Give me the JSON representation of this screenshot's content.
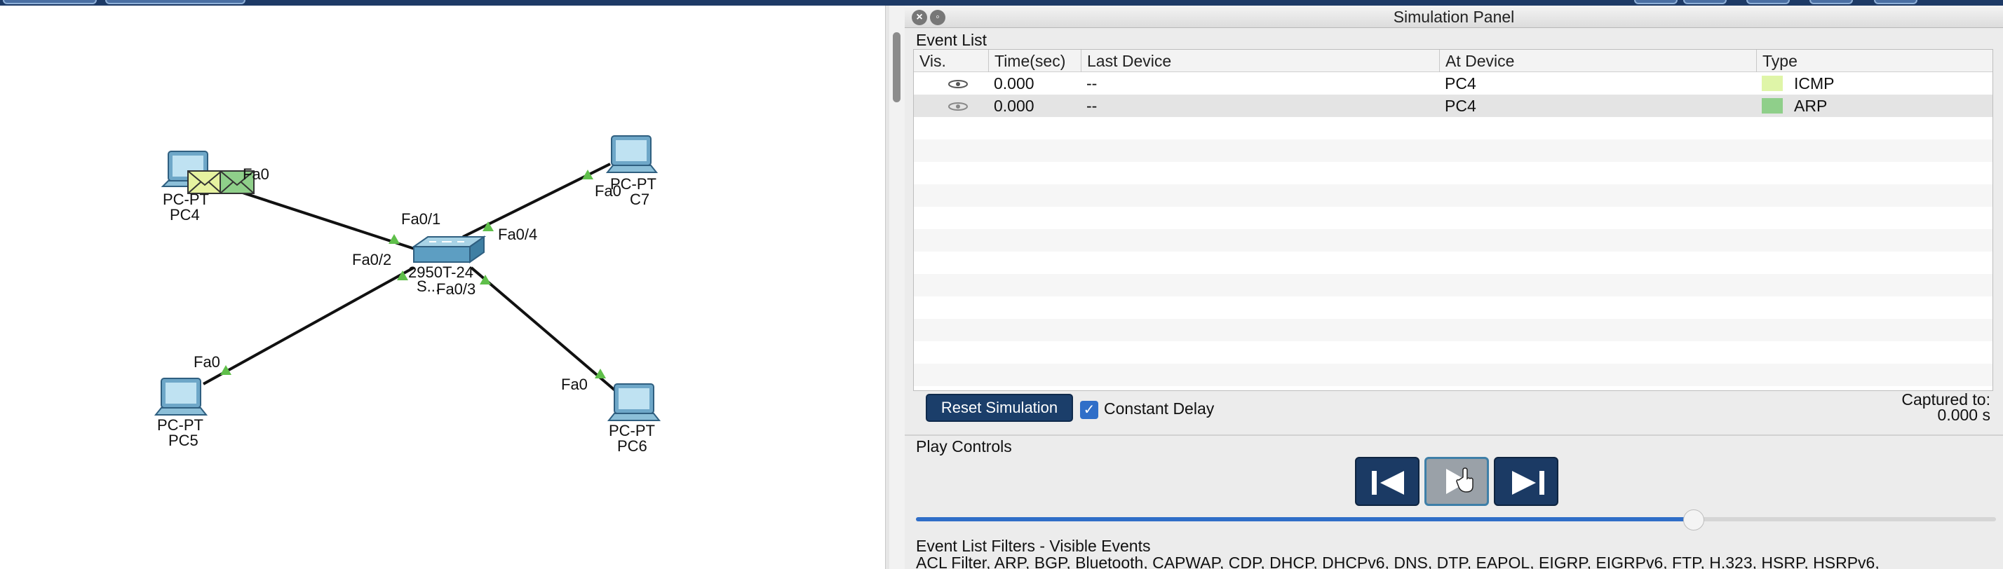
{
  "topology": {
    "devices": {
      "pc4": {
        "model": "PC-PT",
        "name": "PC4"
      },
      "pc5": {
        "model": "PC-PT",
        "name": "PC5"
      },
      "pc6": {
        "model": "PC-PT",
        "name": "PC6"
      },
      "pc7": {
        "model": "PC-PT",
        "name": "C7"
      },
      "switch": {
        "model": "2950T-24",
        "name": "S..."
      }
    },
    "ports": {
      "pc4_fa0": "Fa0",
      "pc5_fa0": "Fa0",
      "pc6_fa0": "Fa0",
      "pc7_fa0": "Fa0",
      "sw_fa01": "Fa0/1",
      "sw_fa02": "Fa0/2",
      "sw_fa03": "Fa0/3",
      "sw_fa04": "Fa0/4"
    }
  },
  "sim_panel": {
    "title": "Simulation Panel",
    "event_list_label": "Event List",
    "columns": [
      "Vis.",
      "Time(sec)",
      "Last Device",
      "At Device",
      "Type"
    ],
    "events": [
      {
        "time": "0.000",
        "last_device": "--",
        "at_device": "PC4",
        "type": "ICMP",
        "color": "#dff5a8"
      },
      {
        "time": "0.000",
        "last_device": "--",
        "at_device": "PC4",
        "type": "ARP",
        "color": "#8fcf8a"
      }
    ],
    "reset_button": "Reset Simulation",
    "constant_delay_label": "Constant Delay",
    "constant_delay_checked": true,
    "captured_label": "Captured to:",
    "captured_value": "0.000 s",
    "play_controls_label": "Play Controls",
    "playback_speed_fraction": 0.72,
    "filters_label": "Event List Filters - Visible Events",
    "filters_text": "ACL Filter, ARP, BGP, Bluetooth, CAPWAP, CDP, DHCP, DHCPv6, DNS, DTP, EAPOL, EIGRP, EIGRPv6, FTP, H.323, HSRP, HSRPv6,"
  },
  "colors": {
    "titlebar": "#1d3a66",
    "button_dark": "#1b3a64",
    "accent_blue": "#2f6ec8",
    "link_green": "#5fbf4a"
  }
}
